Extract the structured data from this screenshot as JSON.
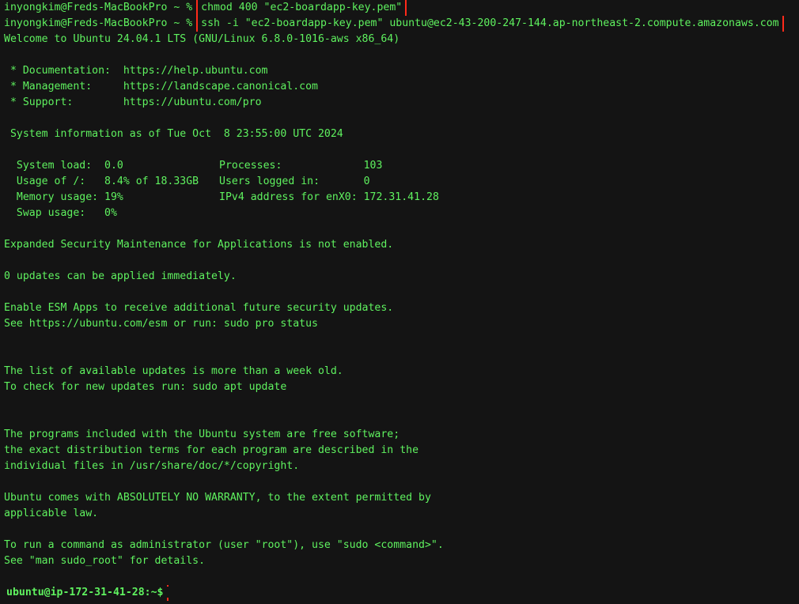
{
  "terminal": {
    "lines": [
      {
        "prompt": "inyongkim@Freds-MacBookPro ~ % ",
        "cmd": "chmod 400 \"ec2-boardapp-key.pem\""
      },
      {
        "prompt": "inyongkim@Freds-MacBookPro ~ % ",
        "cmd": "ssh -i \"ec2-boardapp-key.pem\" ubuntu@ec2-43-200-247-144.ap-northeast-2.compute.amazonaws.com"
      }
    ],
    "welcome": "Welcome to Ubuntu 24.04.1 LTS (GNU/Linux 6.8.0-1016-aws x86_64)",
    "doc": " * Documentation:  https://help.ubuntu.com",
    "mgmt": " * Management:     https://landscape.canonical.com",
    "support": " * Support:        https://ubuntu.com/pro",
    "sysinfo_header": " System information as of Tue Oct  8 23:55:00 UTC 2024",
    "sysinfo": [
      {
        "left": "  System load:  0.0",
        "right": "Processes:             103"
      },
      {
        "left": "  Usage of /:   8.4% of 18.33GB",
        "right": "Users logged in:       0"
      },
      {
        "left": "  Memory usage: 19%",
        "right": "IPv4 address for enX0: 172.31.41.28"
      },
      {
        "left": "  Swap usage:   0%",
        "right": ""
      }
    ],
    "esm": "Expanded Security Maintenance for Applications is not enabled.",
    "updates": "0 updates can be applied immediately.",
    "esm_apps": "Enable ESM Apps to receive additional future security updates.",
    "esm_see": "See https://ubuntu.com/esm or run: sudo pro status",
    "list_old": "The list of available updates is more than a week old.",
    "check_updates": "To check for new updates run: sudo apt update",
    "programs1": "The programs included with the Ubuntu system are free software;",
    "programs2": "the exact distribution terms for each program are described in the",
    "programs3": "individual files in /usr/share/doc/*/copyright.",
    "warranty1": "Ubuntu comes with ABSOLUTELY NO WARRANTY, to the extent permitted by",
    "warranty2": "applicable law.",
    "admin1": "To run a command as administrator (user \"root\"), use \"sudo <command>\".",
    "admin2": "See \"man sudo_root\" for details.",
    "remote_prompt": "ubuntu@ip-172-31-41-28:~$"
  },
  "colors": {
    "background": "#141414",
    "text": "#5ff25f",
    "highlight_box": "#ff2a1a"
  }
}
